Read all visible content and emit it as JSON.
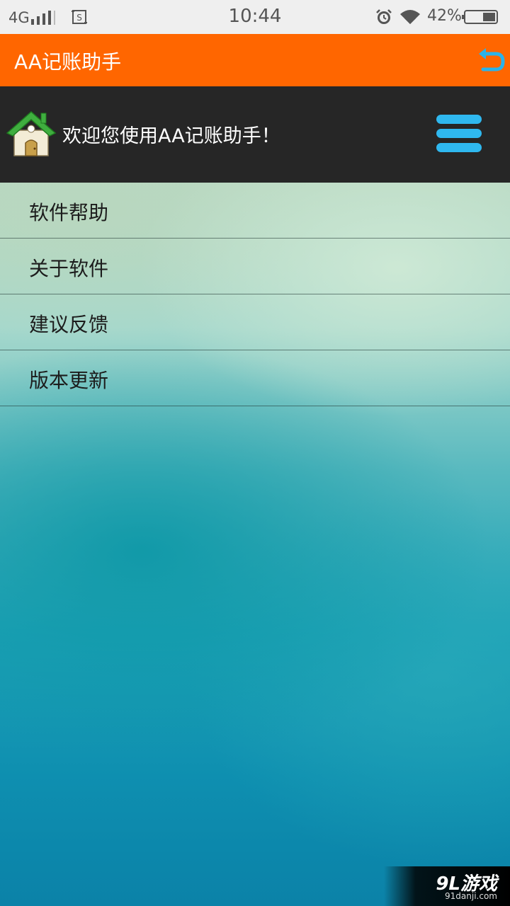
{
  "status_bar": {
    "network": "4G",
    "time": "10:44",
    "battery_percent": "42%",
    "icons": [
      "signal-icon",
      "sim-icon",
      "alarm-icon",
      "wifi-icon",
      "battery-icon"
    ]
  },
  "title_bar": {
    "title": "AA记账助手",
    "background_color": "#ff6600",
    "back_icon": "undo-arrow-icon"
  },
  "header": {
    "welcome": "欢迎您使用AA记账助手！",
    "home_icon": "home-icon",
    "menu_icon": "hamburger-menu-icon",
    "background_color": "#262626"
  },
  "menu": {
    "items": [
      {
        "label": "软件帮助"
      },
      {
        "label": "关于软件"
      },
      {
        "label": "建议反馈"
      },
      {
        "label": "版本更新"
      }
    ]
  },
  "watermark": {
    "logo": "9L游戏",
    "url": "91danji.com"
  }
}
